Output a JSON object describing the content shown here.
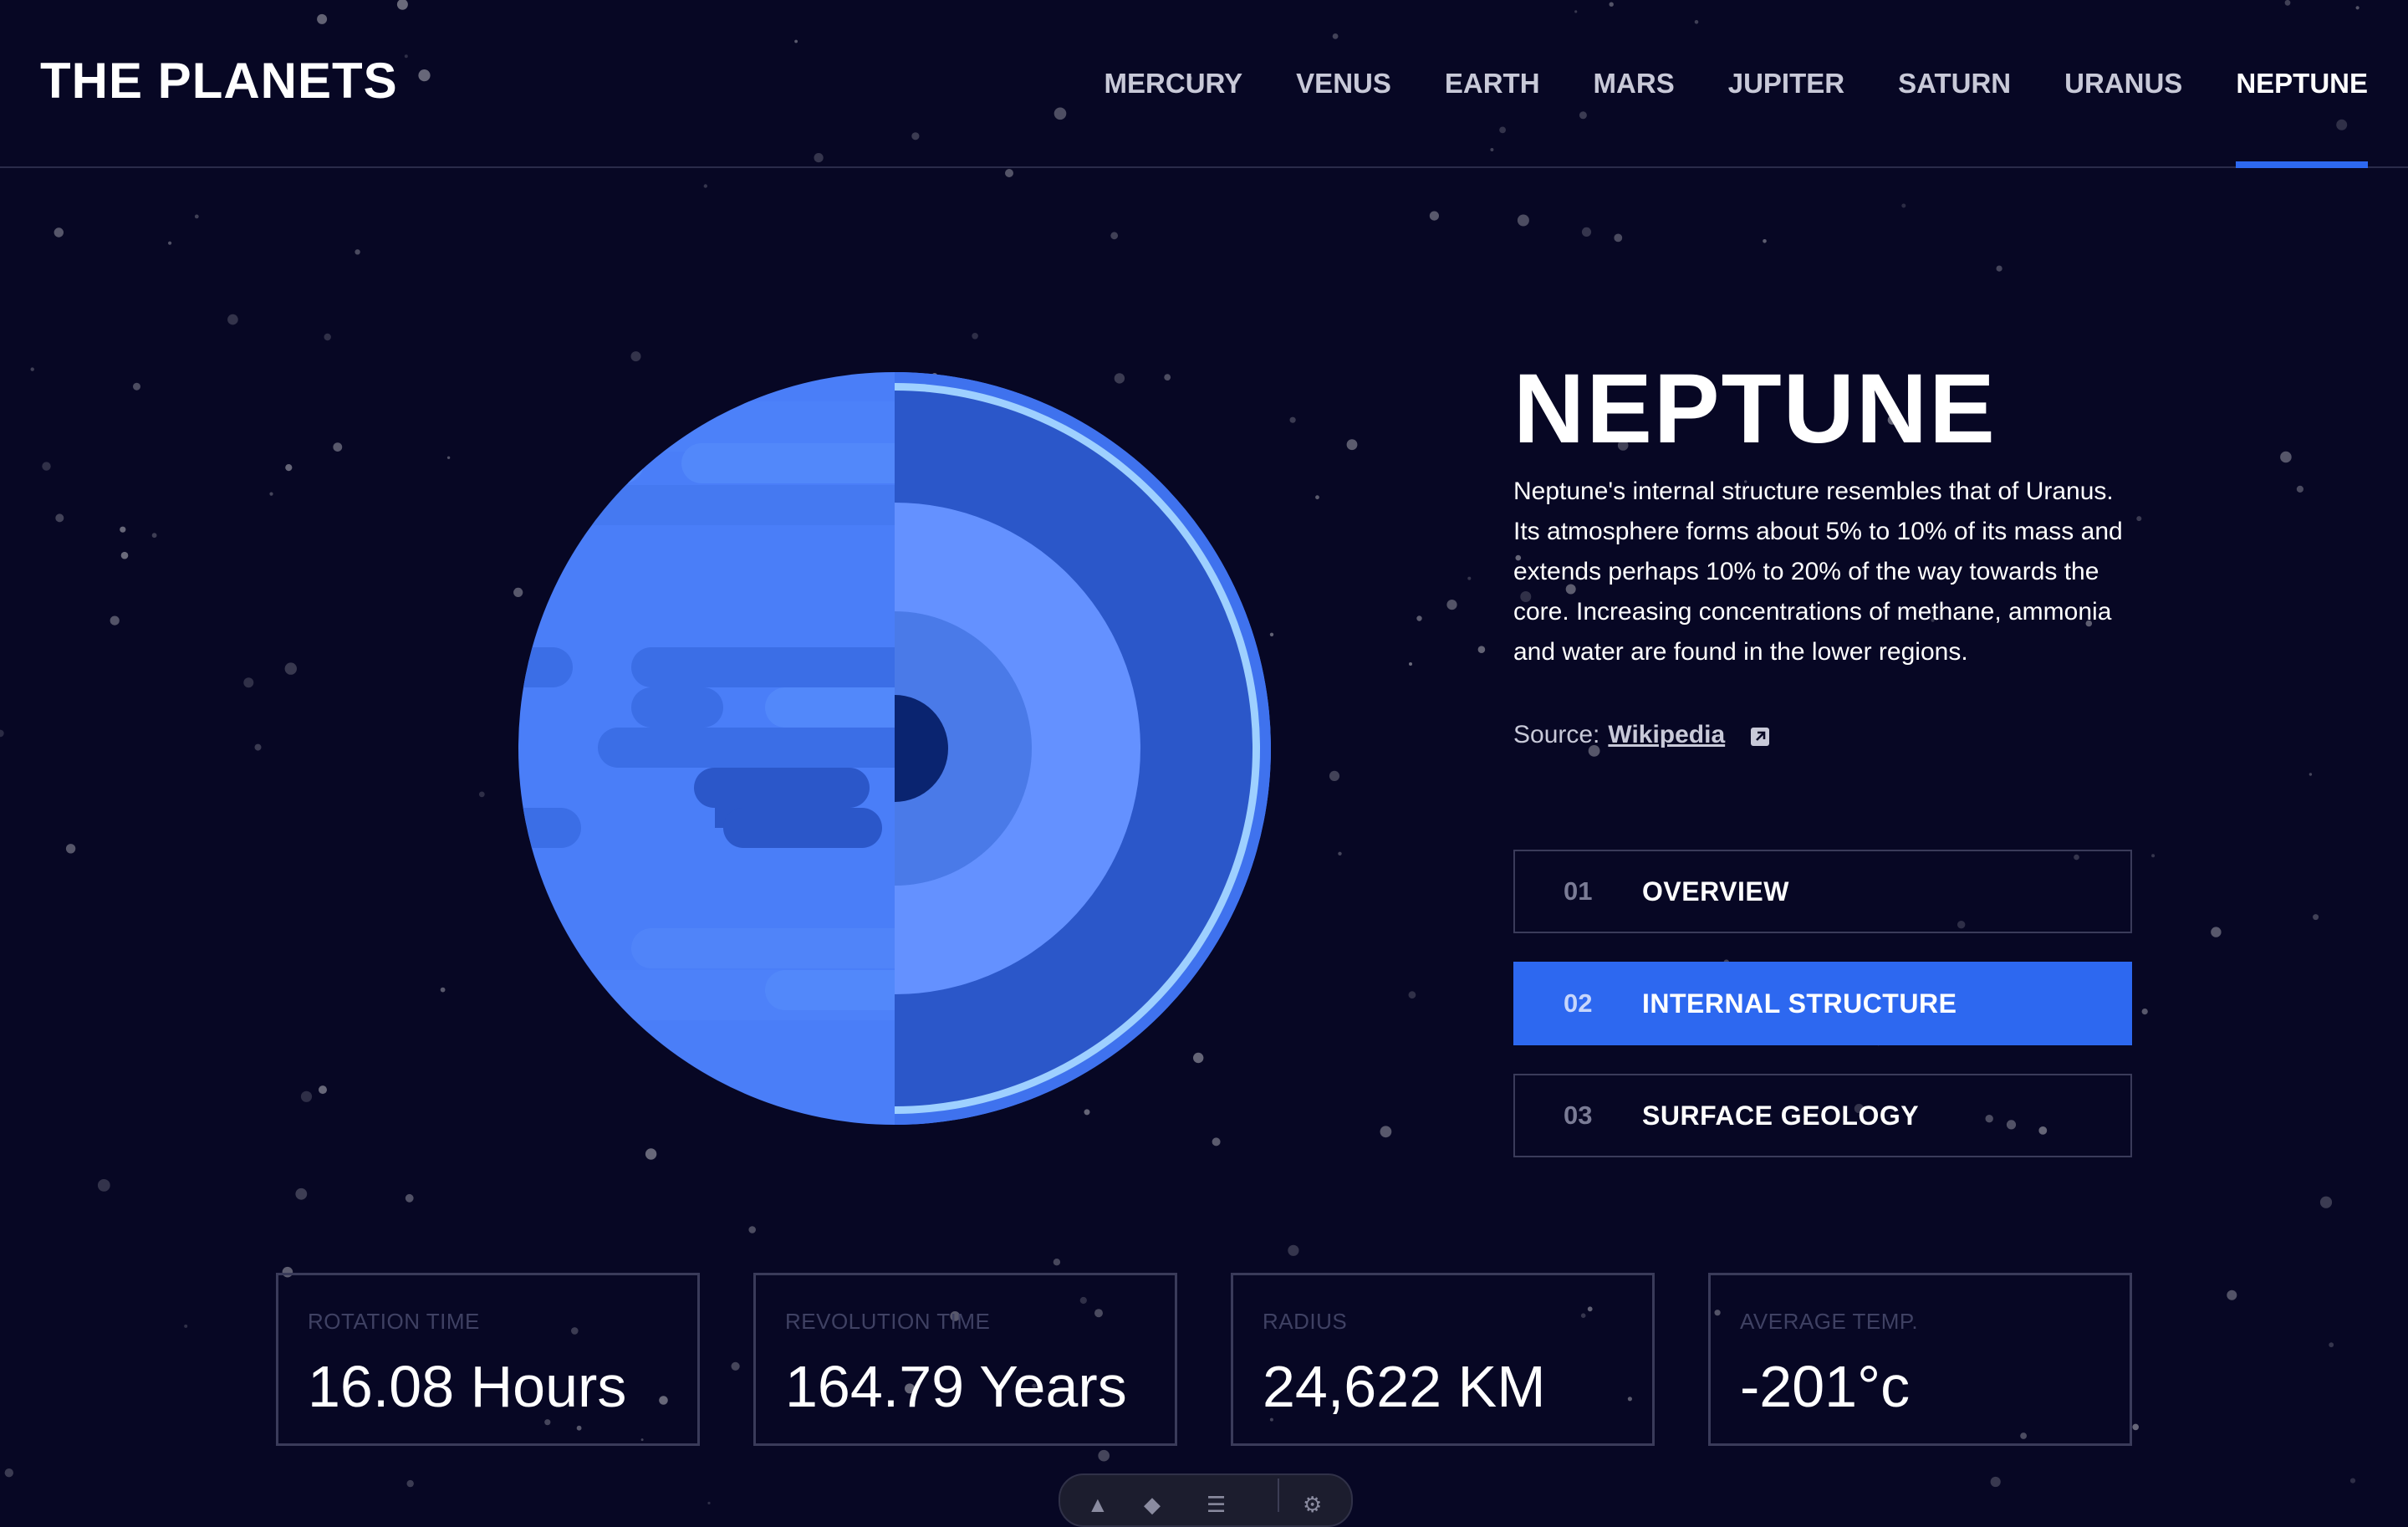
{
  "header": {
    "brand": "THE PLANETS",
    "nav": [
      "MERCURY",
      "VENUS",
      "EARTH",
      "MARS",
      "JUPITER",
      "SATURN",
      "URANUS",
      "NEPTUNE"
    ],
    "active_nav": "NEPTUNE"
  },
  "planet": {
    "name": "NEPTUNE",
    "description": "Neptune's internal structure resembles that of Uranus. Its atmosphere forms about 5% to 10% of its mass and extends perhaps 10% to 20% of the way towards the core. Increasing concentrations of methane, ammonia and water are found in the lower regions.",
    "source_label": "Source:",
    "source_link": "Wikipedia"
  },
  "tabs": [
    {
      "num": "01",
      "label": "OVERVIEW"
    },
    {
      "num": "02",
      "label": "INTERNAL STRUCTURE"
    },
    {
      "num": "03",
      "label": "SURFACE GEOLOGY"
    }
  ],
  "active_tab": "INTERNAL STRUCTURE",
  "stats": [
    {
      "label": "ROTATION TIME",
      "value": "16.08 Hours"
    },
    {
      "label": "REVOLUTION TIME",
      "value": "164.79 Years"
    },
    {
      "label": "RADIUS",
      "value": "24,622 KM"
    },
    {
      "label": "AVERAGE TEMP.",
      "value": "-201°c"
    }
  ],
  "colors": {
    "background": "#070724",
    "accent": "#2d68f0",
    "planet_light": "#4a7ef8",
    "planet_dark": "#2b57c9",
    "ring_highlight": "#9ed0ff"
  },
  "icons": {
    "external_link": "external-link-icon"
  }
}
